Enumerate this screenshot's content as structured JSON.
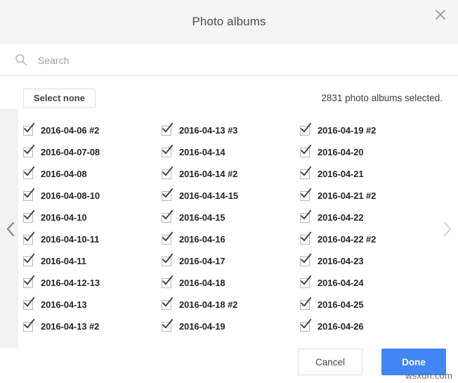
{
  "header": {
    "title": "Photo albums",
    "close_icon": "close-icon"
  },
  "search": {
    "placeholder": "Search",
    "value": "",
    "icon": "search-icon"
  },
  "toolbar": {
    "select_none_label": "Select none",
    "selected_count_text": "2831 photo albums selected."
  },
  "navigation": {
    "prev_icon": "chevron-left-icon",
    "next_icon": "chevron-right-icon"
  },
  "columns": [
    {
      "items": [
        {
          "label": "2016-04-06 #2",
          "checked": true
        },
        {
          "label": "2016-04-07-08",
          "checked": true
        },
        {
          "label": "2016-04-08",
          "checked": true
        },
        {
          "label": "2016-04-08-10",
          "checked": true
        },
        {
          "label": "2016-04-10",
          "checked": true
        },
        {
          "label": "2016-04-10-11",
          "checked": true
        },
        {
          "label": "2016-04-11",
          "checked": true
        },
        {
          "label": "2016-04-12-13",
          "checked": true
        },
        {
          "label": "2016-04-13",
          "checked": true
        },
        {
          "label": "2016-04-13 #2",
          "checked": true
        }
      ]
    },
    {
      "items": [
        {
          "label": "2016-04-13 #3",
          "checked": true
        },
        {
          "label": "2016-04-14",
          "checked": true
        },
        {
          "label": "2016-04-14 #2",
          "checked": true
        },
        {
          "label": "2016-04-14-15",
          "checked": true
        },
        {
          "label": "2016-04-15",
          "checked": true
        },
        {
          "label": "2016-04-16",
          "checked": true
        },
        {
          "label": "2016-04-17",
          "checked": true
        },
        {
          "label": "2016-04-18",
          "checked": true
        },
        {
          "label": "2016-04-18 #2",
          "checked": true
        },
        {
          "label": "2016-04-19",
          "checked": true
        }
      ]
    },
    {
      "items": [
        {
          "label": "2016-04-19 #2",
          "checked": true
        },
        {
          "label": "2016-04-20",
          "checked": true
        },
        {
          "label": "2016-04-21",
          "checked": true
        },
        {
          "label": "2016-04-21 #2",
          "checked": true
        },
        {
          "label": "2016-04-22",
          "checked": true
        },
        {
          "label": "2016-04-22 #2",
          "checked": true
        },
        {
          "label": "2016-04-23",
          "checked": true
        },
        {
          "label": "2016-04-24",
          "checked": true
        },
        {
          "label": "2016-04-25",
          "checked": true
        },
        {
          "label": "2016-04-26",
          "checked": true
        }
      ]
    }
  ],
  "footer": {
    "cancel_label": "Cancel",
    "done_label": "Done"
  },
  "watermark": {
    "text": "wsxdn.com"
  },
  "colors": {
    "accent": "#4285f4",
    "header_bg": "#f5f5f5",
    "rail_bg": "#f1f1f1",
    "text": "#262626"
  }
}
